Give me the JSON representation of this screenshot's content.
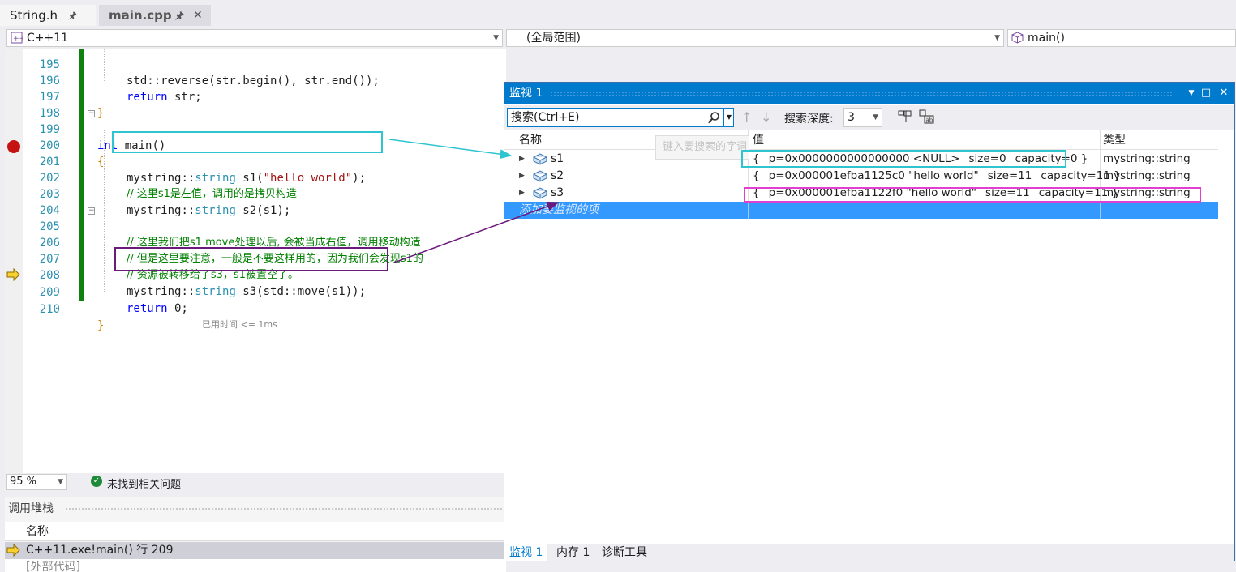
{
  "tabs": [
    {
      "label": "String.h",
      "pin": "🖈"
    },
    {
      "label": "main.cpp",
      "pin": "🖈",
      "close": "✕"
    }
  ],
  "navbar": {
    "project": "C++11",
    "scope": "(全局范围)",
    "member": "main()"
  },
  "editor": {
    "lines": [
      {
        "num": "195",
        "code": "std::reverse(str.begin(), str.end());"
      },
      {
        "num": "196",
        "code_kw": "return",
        "code_rest": " str;"
      },
      {
        "num": "197",
        "brace": "}"
      },
      {
        "num": "198"
      },
      {
        "num": "199",
        "code_kw": "int",
        "code_rest": " main()"
      },
      {
        "num": "200",
        "brace": "{"
      },
      {
        "num": "201",
        "ns": "mystring",
        "sep": "::",
        "ty": "string",
        "rest1": " s1(",
        "str": "\"hello world\"",
        "rest2": ");"
      },
      {
        "num": "202",
        "comment": "// 这里s1是左值，调用的是拷贝构造"
      },
      {
        "num": "203",
        "ns": "mystring",
        "sep": "::",
        "ty": "string",
        "rest1": " s2(s1);"
      },
      {
        "num": "204"
      },
      {
        "num": "205",
        "comment": "// 这里我们把s1 move处理以后, 会被当成右值，调用移动构造"
      },
      {
        "num": "206",
        "comment": "// 但是这里要注意，一般是不要这样用的，因为我们会发现s1的"
      },
      {
        "num": "207",
        "comment": "// 资源被转移给了s3，s1被置空了。"
      },
      {
        "num": "208",
        "ns": "mystring",
        "sep": "::",
        "ty": "string",
        "rest1": " s3(std::move(s1));"
      },
      {
        "num": "209",
        "code_kw": "return",
        "code_rest": " 0;",
        "elapsed": "已用时间 <= 1ms"
      },
      {
        "num": "210",
        "brace": "}"
      }
    ]
  },
  "status": {
    "zoom": "95 %",
    "issues": "未找到相关问题"
  },
  "callstack": {
    "title": "调用堆栈",
    "header": "名称",
    "rows": [
      "C++11.exe!main() 行 209",
      "[外部代码]"
    ]
  },
  "watch": {
    "title": "监视 1",
    "search_placeholder": "搜索(Ctrl+E)",
    "depth_label": "搜索深度:",
    "depth_value": "3",
    "columns": {
      "name": "名称",
      "value": "值",
      "type": "类型"
    },
    "tooltip": "键入要搜索的字词",
    "rows": [
      {
        "name": "s1",
        "value": "{ _p=0x0000000000000000 <NULL> _size=0 _capacity=0 }",
        "type": "mystring::string"
      },
      {
        "name": "s2",
        "value": "{ _p=0x000001efba1125c0 \"hello world\" _size=11 _capacity=11 }",
        "type": "mystring::string"
      },
      {
        "name": "s3",
        "value": "{ _p=0x000001efba1122f0 \"hello world\" _size=11 _capacity=11 }",
        "type": "mystring::string"
      }
    ],
    "add_item": "添加要监视的项",
    "bottom_tabs": [
      "监视 1",
      "内存 1",
      "诊断工具"
    ]
  },
  "colors": {
    "accent": "#007acc",
    "highlight_cyan": "#2ec4d0",
    "highlight_purple": "#6a1a7a",
    "highlight_magenta": "#e040d0",
    "breakpoint": "#c51313"
  }
}
